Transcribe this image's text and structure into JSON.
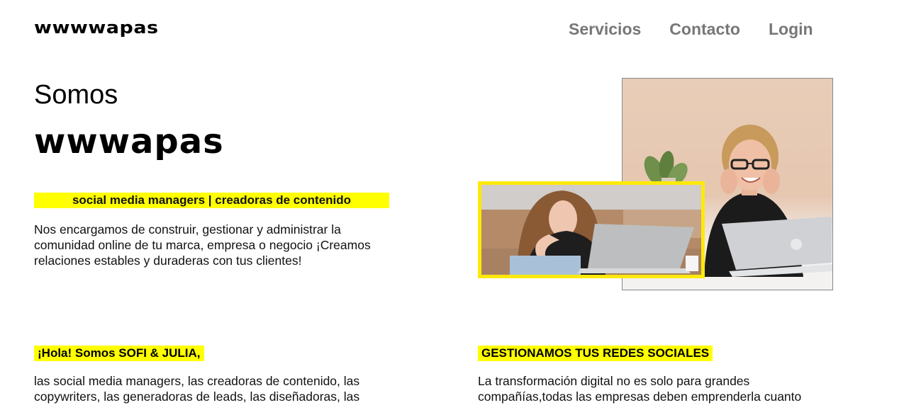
{
  "header": {
    "logo": "wwwwapas",
    "nav": [
      "Servicios",
      "Contacto",
      "Login"
    ]
  },
  "hero": {
    "intro": "Somos",
    "brand": "wwwapas",
    "tagline": "social media managers | creadoras de contenido",
    "description": "Nos encargamos de construir, gestionar y administrar la comunidad online de tu marca, empresa o negocio ¡Creamos relaciones estables y duraderas con tus clientes!"
  },
  "about": {
    "heading": "¡Hola! Somos SOFI & JULIA,",
    "text": "las social media managers, las creadoras de contenido, las copywriters, las generadoras de leads, las diseñadoras, las"
  },
  "services": {
    "heading": "GESTIONAMOS TUS REDES SOCIALES",
    "text": "La transformación digital no es solo para grandes compañías,todas las empresas deben emprenderla cuanto"
  },
  "colors": {
    "highlight": "#ffff00",
    "frame": "#ffe90a",
    "nav": "#777777"
  }
}
